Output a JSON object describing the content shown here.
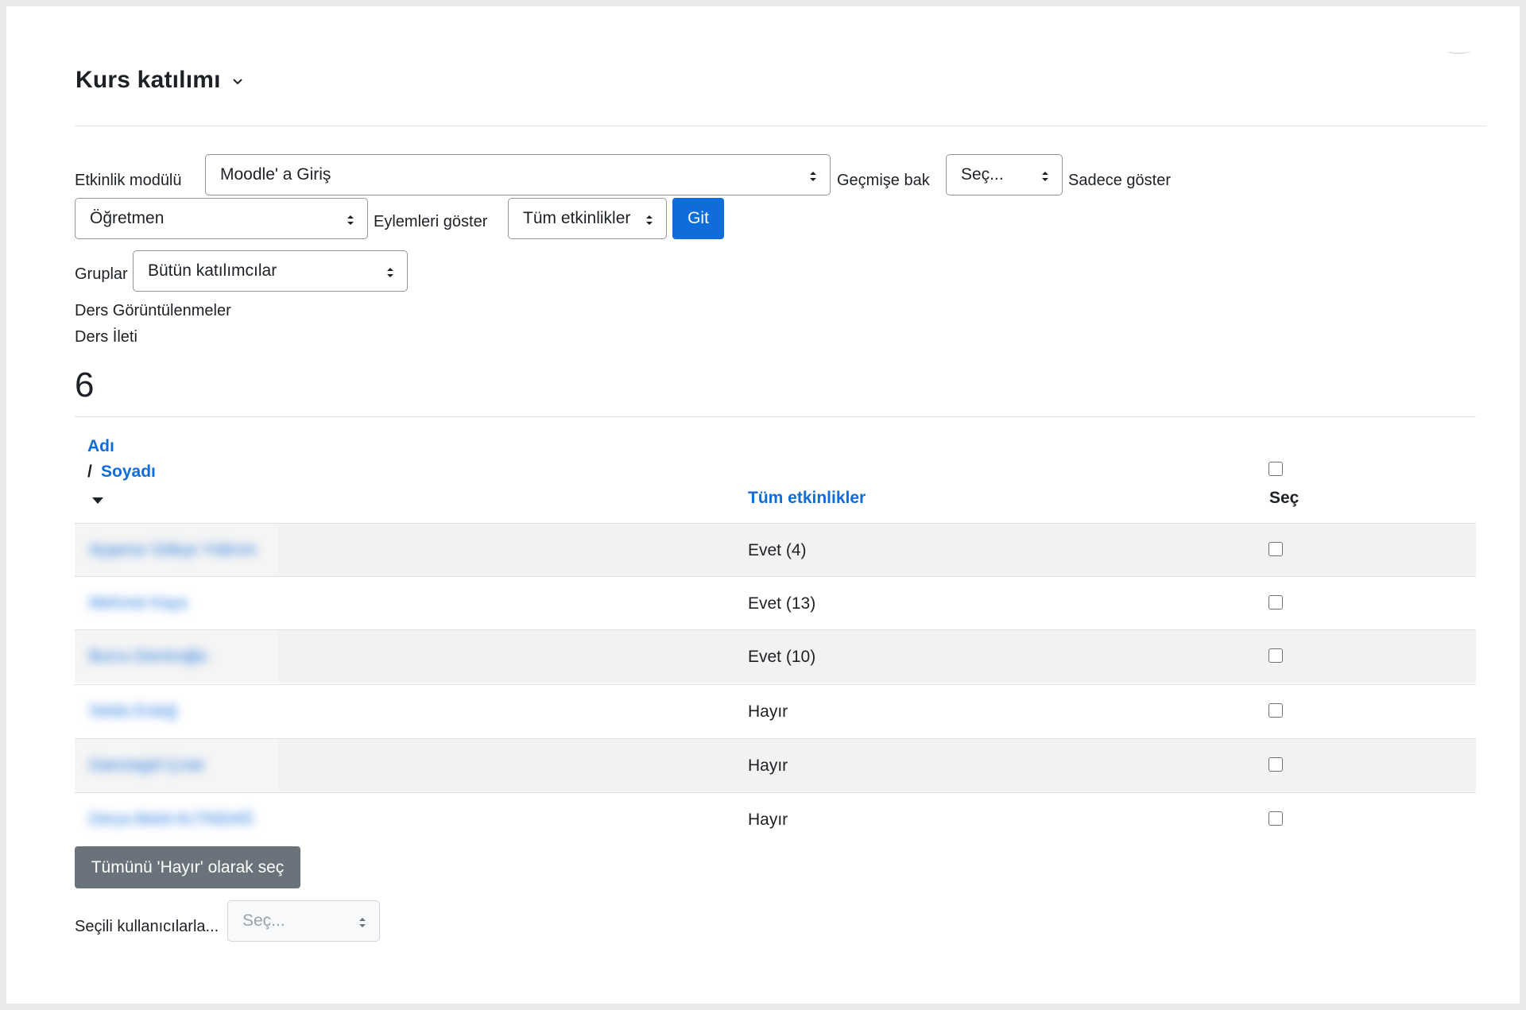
{
  "page": {
    "title": "Kurs katılımı"
  },
  "filters": {
    "activity_module_label": "Etkinlik modülü",
    "activity_module_value": "Moodle' a Giriş",
    "history_label": "Geçmişe bak",
    "history_value": "Seç...",
    "show_only_label": "Sadece göster",
    "role_value": "Öğretmen",
    "show_actions_label": "Eylemleri göster",
    "actions_value": "Tüm etkinlikler",
    "go_button": "Git",
    "groups_label": "Gruplar",
    "groups_value": "Bütün katılımcılar",
    "course_views": "Ders Görüntülenmeler",
    "course_posts": "Ders İleti"
  },
  "summary": {
    "count": "6"
  },
  "table": {
    "col_first_name": "Adı",
    "col_separator": "/",
    "col_last_name": "Soyadı",
    "col_all_activities": "Tüm etkinlikler",
    "col_select": "Seç",
    "rows": [
      {
        "name": "Ayşenur Gökçe Yıldırım",
        "status": "Evet (4)"
      },
      {
        "name": "Mehmet Kaya",
        "status": "Evet (13)"
      },
      {
        "name": "Burcu Demiroğlu",
        "status": "Evet (10)"
      },
      {
        "name": "Selda Erdoğ",
        "status": "Hayır"
      },
      {
        "name": "Gamzegül Çınar",
        "status": "Hayır"
      },
      {
        "name": "Derya Betül ALTINDAĞ",
        "status": "Hayır"
      }
    ]
  },
  "actions": {
    "select_all_no_button": "Tümünü 'Hayır' olarak seç",
    "with_selected_label": "Seçili kullanıcılarla...",
    "with_selected_value": "Seç..."
  }
}
